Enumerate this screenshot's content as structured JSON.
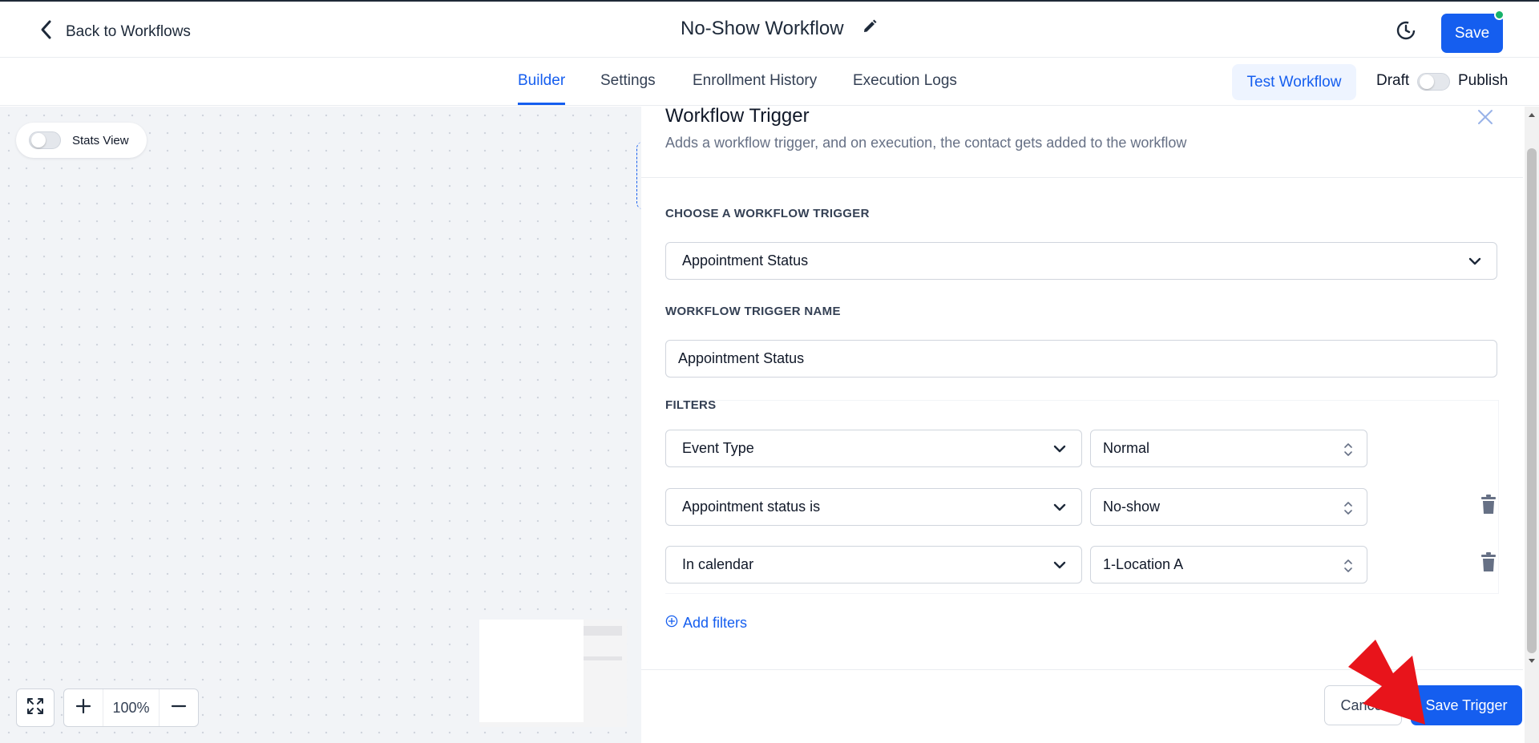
{
  "header": {
    "back_label": "Back to Workflows",
    "title": "No-Show Workflow",
    "save_label": "Save"
  },
  "tabs": [
    {
      "label": "Builder",
      "active": true
    },
    {
      "label": "Settings",
      "active": false
    },
    {
      "label": "Enrollment History",
      "active": false
    },
    {
      "label": "Execution Logs",
      "active": false
    }
  ],
  "actions": {
    "test_workflow": "Test Workflow",
    "draft_label": "Draft",
    "publish_label": "Publish",
    "published": false
  },
  "canvas": {
    "stats_view_label": "Stats View",
    "stats_view_enabled": false,
    "zoom_level": "100%"
  },
  "panel": {
    "title": "Workflow Trigger",
    "subtitle": "Adds a workflow trigger, and on execution, the contact gets added to the workflow",
    "choose_trigger_label": "CHOOSE A WORKFLOW TRIGGER",
    "trigger_value": "Appointment Status",
    "trigger_name_label": "WORKFLOW TRIGGER NAME",
    "trigger_name_value": "Appointment Status",
    "filters_label": "FILTERS",
    "filters": [
      {
        "field": "Event Type",
        "value": "Normal",
        "deletable": false
      },
      {
        "field": "Appointment status is",
        "value": "No-show",
        "deletable": true
      },
      {
        "field": "In calendar",
        "value": "1-Location A",
        "deletable": true
      }
    ],
    "add_filters_label": "Add filters",
    "cancel_label": "Cancel",
    "save_trigger_label": "Save Trigger"
  },
  "colors": {
    "primary": "#155eef",
    "status_dot": "#17b26a",
    "annotation_arrow": "#e8141b"
  }
}
